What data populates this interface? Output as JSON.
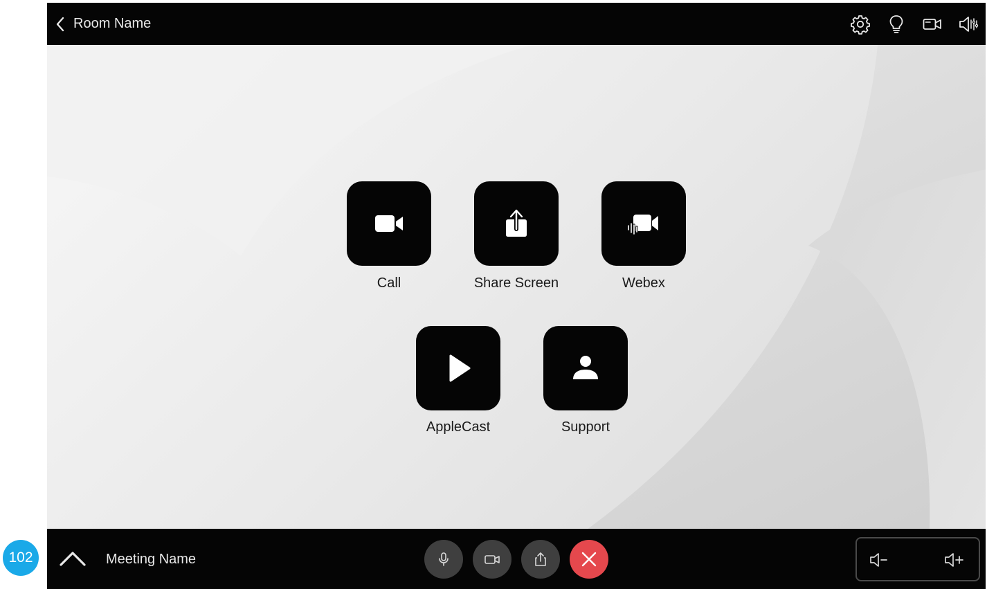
{
  "callout": {
    "number": "102"
  },
  "header": {
    "room_name": "Room Name",
    "icons": [
      "settings-icon",
      "lightbulb-icon",
      "camera-icon",
      "speaker-icon"
    ]
  },
  "tiles": [
    {
      "label": "Call",
      "icon": "video-camera-icon"
    },
    {
      "label": "Share Screen",
      "icon": "share-upload-icon"
    },
    {
      "label": "Webex",
      "icon": "webex-icon"
    },
    {
      "label": "AppleCast",
      "icon": "play-icon"
    },
    {
      "label": "Support",
      "icon": "person-icon"
    }
  ],
  "footer": {
    "meeting_name": "Meeting Name",
    "controls": [
      "microphone-icon",
      "video-icon",
      "share-icon",
      "end-call-icon"
    ],
    "volume": [
      "volume-down-icon",
      "volume-up-icon"
    ]
  },
  "colors": {
    "bar": "#050505",
    "tile": "#050505",
    "control": "#3f3f3f",
    "end_call": "#e5484d",
    "callout": "#1aa9e8"
  }
}
